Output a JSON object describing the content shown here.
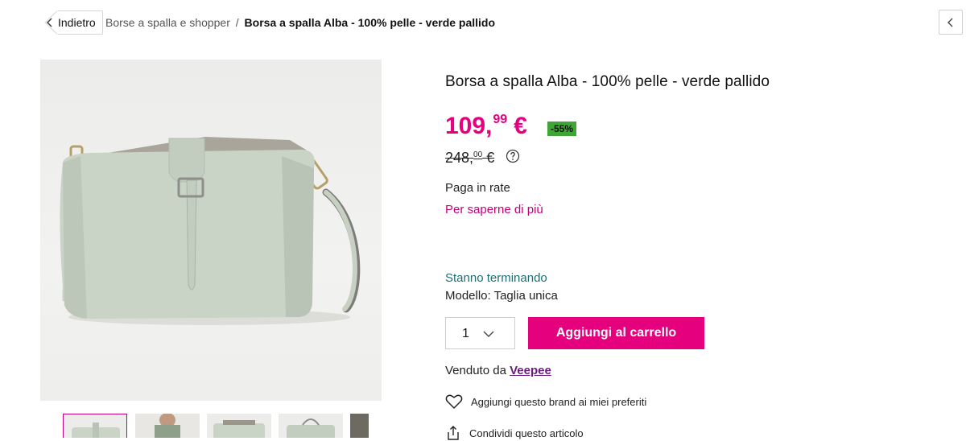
{
  "nav": {
    "back_label": "Indietro",
    "breadcrumb_category": "Borse a spalla e shopper",
    "breadcrumb_separator": "/",
    "breadcrumb_current": "Borsa a spalla Alba - 100% pelle - verde pallido"
  },
  "product": {
    "title": "Borsa a spalla Alba - 100% pelle - verde pallido",
    "price_int": "109,",
    "price_dec": "99",
    "currency": "€",
    "discount": "-55%",
    "old_price_int": "248,",
    "old_price_dec": "00",
    "installments_label": "Paga in rate",
    "learn_more_label": "Per saperne di più",
    "stock_status": "Stanno terminando",
    "model_label": "Modello: Taglia unica",
    "quantity": "1",
    "add_to_cart_label": "Aggiungi al carrello",
    "sold_by_label": "Venduto da",
    "seller_name": "Veepee",
    "favorite_label": "Aggiungi questo brand ai miei preferiti",
    "share_label": "Condividi questo articolo"
  },
  "colors": {
    "accent_pink": "#e5007e",
    "discount_green": "#3fa535",
    "stock_teal": "#1b6e75",
    "seller_purple": "#6b1a7d",
    "bag_green": "#c9d3c6"
  },
  "icons": [
    "chevron-left-icon",
    "chevron-down-icon",
    "help-circle-icon",
    "heart-icon",
    "share-icon"
  ]
}
